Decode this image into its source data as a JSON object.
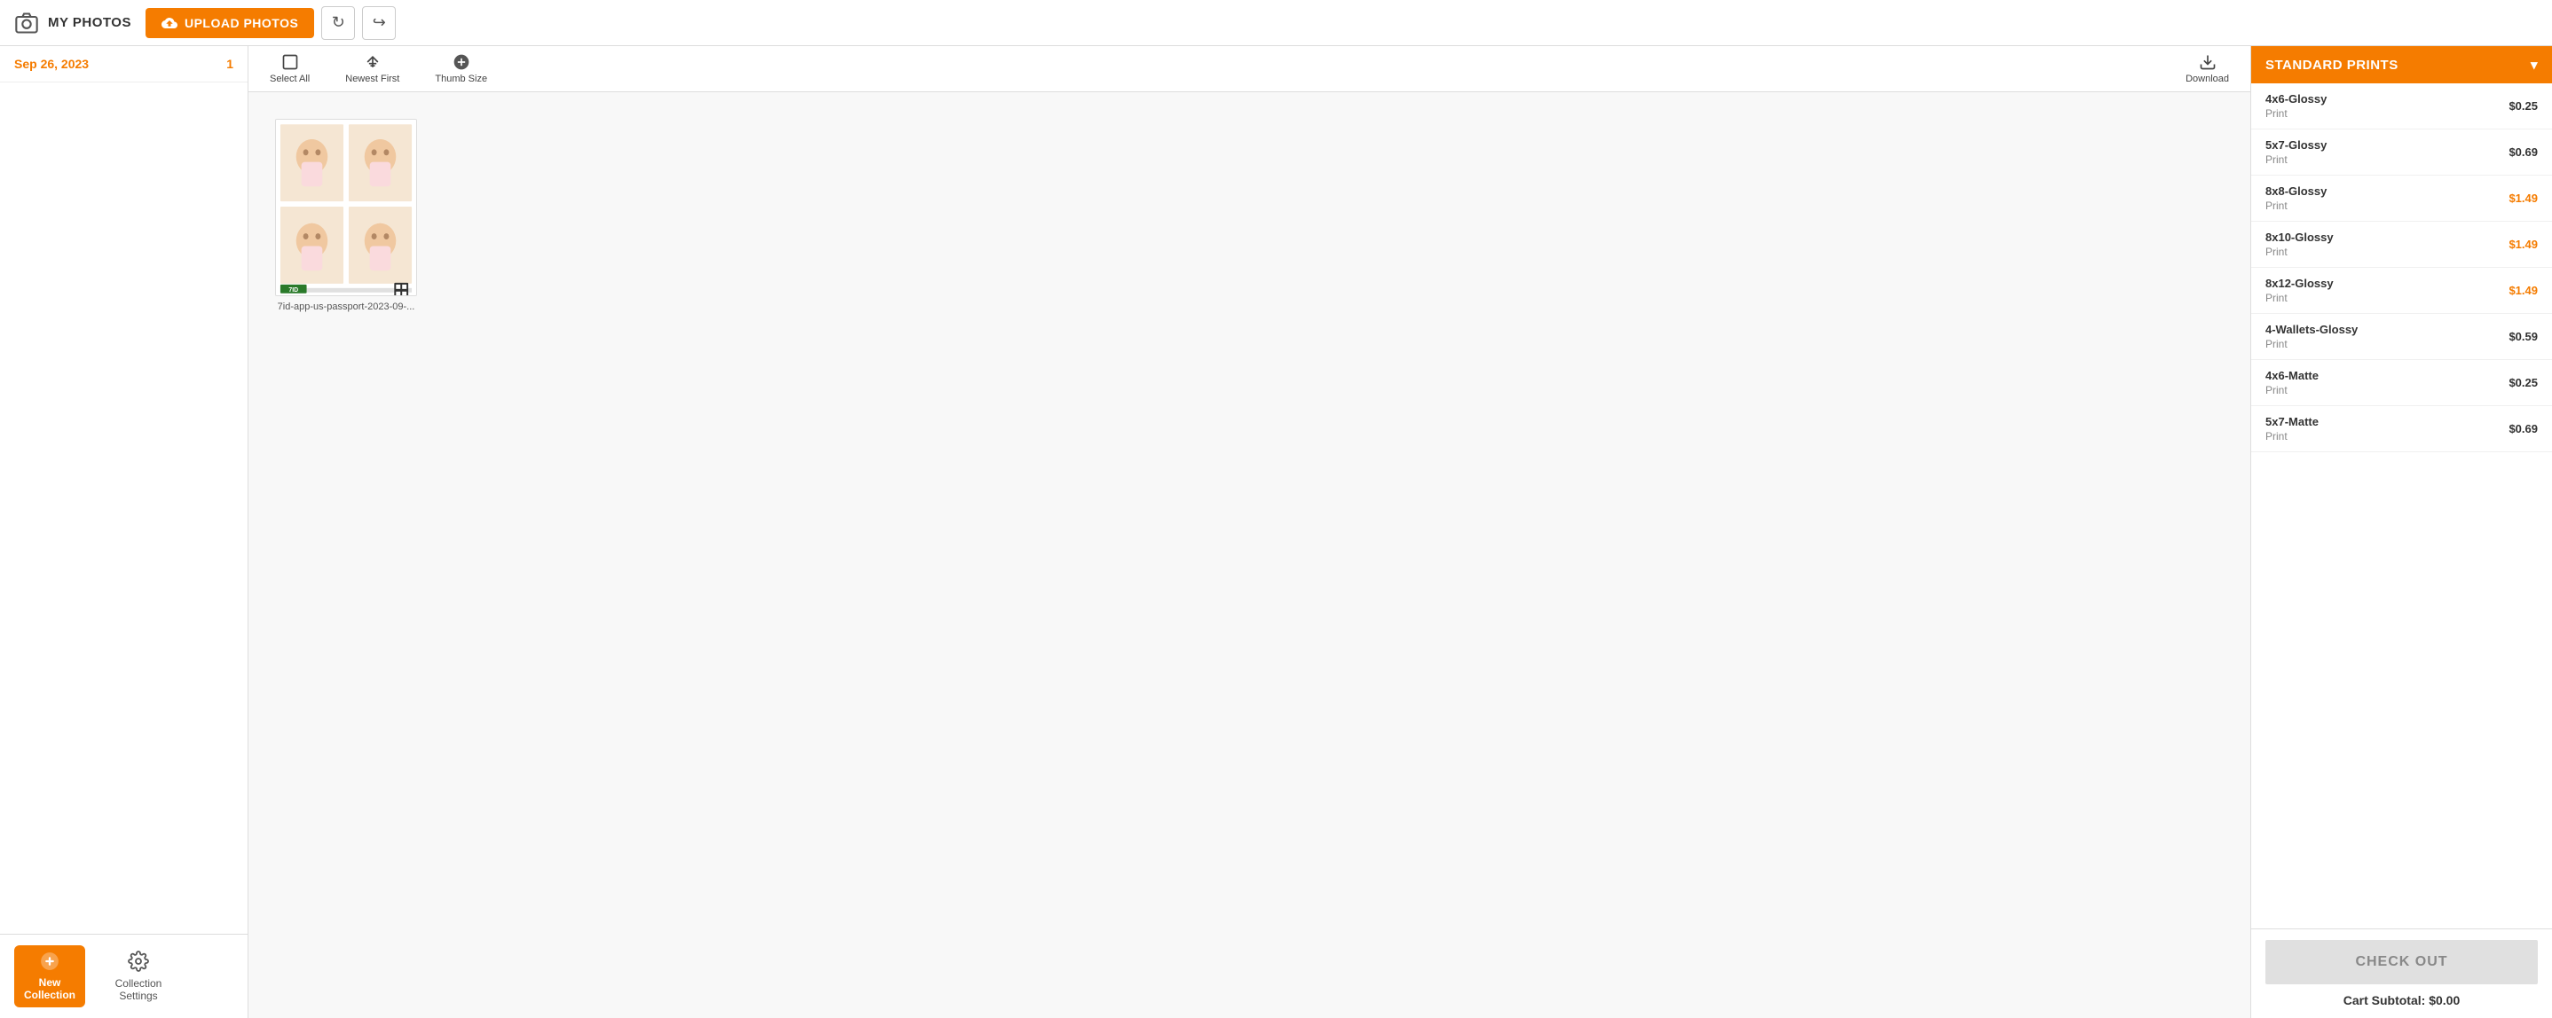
{
  "topbar": {
    "my_photos_label": "MY PHOTOS",
    "upload_btn_label": "UPLOAD PHOTOS",
    "refresh_icon": "↻",
    "share_icon": "↪"
  },
  "sidebar": {
    "date_label": "Sep 26, 2023",
    "date_count": "1",
    "new_collection_label": "New Collection",
    "collection_settings_label": "Collection Settings"
  },
  "toolbar": {
    "select_all_label": "Select All",
    "newest_first_label": "Newest First",
    "thumb_size_label": "Thumb Size",
    "download_label": "Download"
  },
  "photo": {
    "filename": "7id-app-us-passport-2023-09-..."
  },
  "right_panel": {
    "header_label": "STANDARD PRINTS",
    "chevron": "▾",
    "prints": [
      {
        "name": "4x6-Glossy",
        "type": "Print",
        "price": "$0.25",
        "highlight": false
      },
      {
        "name": "5x7-Glossy",
        "type": "Print",
        "price": "$0.69",
        "highlight": false
      },
      {
        "name": "8x8-Glossy",
        "type": "Print",
        "price": "$1.49",
        "highlight": true
      },
      {
        "name": "8x10-Glossy",
        "type": "Print",
        "price": "$1.49",
        "highlight": true
      },
      {
        "name": "8x12-Glossy",
        "type": "Print",
        "price": "$1.49",
        "highlight": true
      },
      {
        "name": "4-Wallets-Glossy",
        "type": "Print",
        "price": "$0.59",
        "highlight": false
      },
      {
        "name": "4x6-Matte",
        "type": "Print",
        "price": "$0.25",
        "highlight": false
      },
      {
        "name": "5x7-Matte",
        "type": "Print",
        "price": "$0.69",
        "highlight": false
      }
    ],
    "checkout_label": "CHECK OUT",
    "cart_subtotal_label": "Cart Subtotal: $0.00"
  }
}
